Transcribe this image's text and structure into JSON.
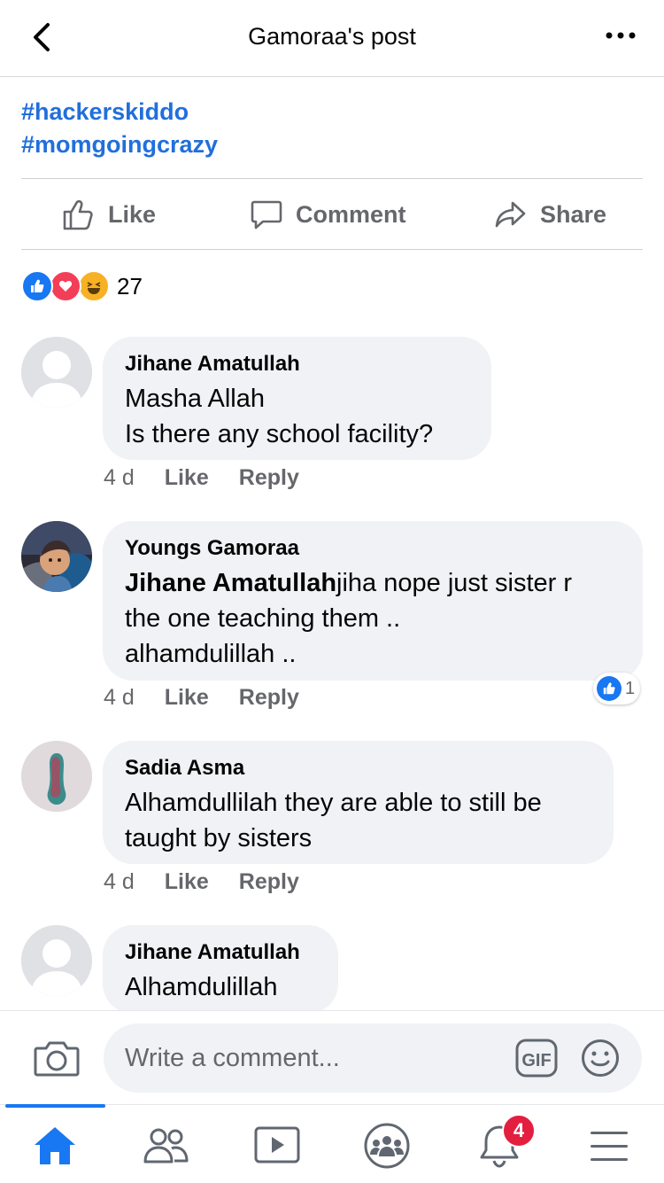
{
  "header": {
    "title": "Gamoraa's post"
  },
  "post": {
    "hashtags": [
      "#hackerskiddo",
      "#momgoingcrazy"
    ],
    "actions": {
      "like": "Like",
      "comment": "Comment",
      "share": "Share"
    },
    "reaction_count": "27"
  },
  "comments": [
    {
      "author": "Jihane Amatullah",
      "lines": [
        "Masha Allah",
        "Is there any school facility?"
      ],
      "time": "4 d",
      "like": "Like",
      "reply": "Reply"
    },
    {
      "author": "Youngs Gamoraa",
      "mention": "Jihane Amatullah",
      "text_line1": "jiha nope just sister r",
      "text_line2": "the one teaching them ..",
      "text_line3": "alhamdulillah ..",
      "time": "4 d",
      "like": "Like",
      "reply": "Reply",
      "like_badge_count": "1"
    },
    {
      "author": "Sadia Asma",
      "lines": [
        "Alhamdullilah they are able to still be",
        "taught by sisters"
      ],
      "time": "4 d",
      "like": "Like",
      "reply": "Reply"
    },
    {
      "author": "Jihane Amatullah",
      "lines": [
        "Alhamdulillah"
      ]
    }
  ],
  "composer": {
    "placeholder": "Write a comment..."
  },
  "tabbar": {
    "notifications_badge": "4"
  },
  "colors": {
    "accent": "#1877f2",
    "hashtag": "#216fdb",
    "bubble": "#f0f2f5",
    "badge": "#e41e3f"
  }
}
